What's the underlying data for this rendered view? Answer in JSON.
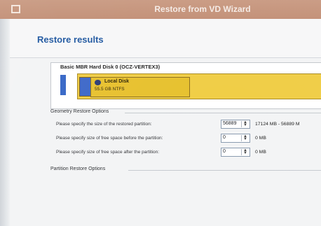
{
  "window": {
    "title": "Restore from VD Wizard",
    "icon": "window-icon"
  },
  "page": {
    "title": "Restore results"
  },
  "disk": {
    "label": "Basic MBR Hard Disk 0 (OCZ-VERTEX3)",
    "partition_name": "Local Disk",
    "partition_size": "55.5 GB NTFS"
  },
  "geometry": {
    "title": "Geometry Restore Options",
    "rows": [
      {
        "label": "Please specify the size of the restored partition:",
        "value": "56889",
        "result": "17124 MB - 56889 M"
      },
      {
        "label": "Please specify size of free space before the partition:",
        "value": "0",
        "result": "0 MB"
      },
      {
        "label": "Please specify size of free space after the partition:",
        "value": "0",
        "result": "0 MB"
      }
    ]
  },
  "partition_restore": {
    "title": "Partition Restore Options"
  },
  "colors": {
    "titlebar": "#c99a82",
    "page_title": "#1f57a0",
    "partition_fill": "#f0cd45",
    "partition_border": "#a88a23",
    "disk_blue": "#3d68c8"
  }
}
